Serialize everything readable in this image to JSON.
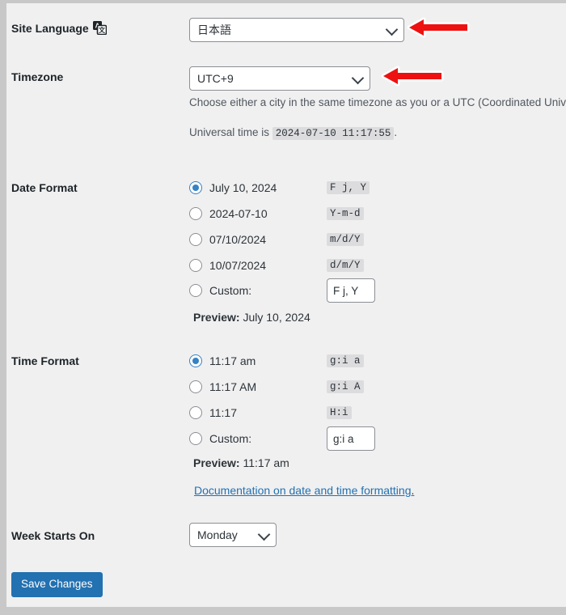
{
  "page": {
    "background": "#c8c8c8",
    "panel_background": "#f0f0f1",
    "accent": "#2271b1",
    "radio_accent": "#3582c4",
    "arrow_color": "#ee1111"
  },
  "site_language": {
    "label": "Site Language",
    "icon": "translation-icon",
    "value": "日本語"
  },
  "timezone": {
    "label": "Timezone",
    "value": "UTC+9",
    "description": "Choose either a city in the same timezone as you or a UTC (Coordinated Universal Time) time offset.",
    "universal_time_prefix": "Universal time is",
    "universal_time_value": "2024-07-10 11:17:55",
    "universal_time_suffix": "."
  },
  "date_format": {
    "label": "Date Format",
    "options": [
      {
        "display": "July 10, 2024",
        "code": "F j, Y",
        "selected": true
      },
      {
        "display": "2024-07-10",
        "code": "Y-m-d",
        "selected": false
      },
      {
        "display": "07/10/2024",
        "code": "m/d/Y",
        "selected": false
      },
      {
        "display": "10/07/2024",
        "code": "d/m/Y",
        "selected": false
      }
    ],
    "custom_label": "Custom:",
    "custom_selected": false,
    "custom_value": "F j, Y",
    "preview_label": "Preview:",
    "preview_value": "July 10, 2024"
  },
  "time_format": {
    "label": "Time Format",
    "options": [
      {
        "display": "11:17 am",
        "code": "g:i a",
        "selected": true
      },
      {
        "display": "11:17 AM",
        "code": "g:i A",
        "selected": false
      },
      {
        "display": "11:17",
        "code": "H:i",
        "selected": false
      }
    ],
    "custom_label": "Custom:",
    "custom_selected": false,
    "custom_value": "g:i a",
    "preview_label": "Preview:",
    "preview_value": "11:17 am",
    "doc_link": "Documentation on date and time formatting",
    "doc_link_period": "."
  },
  "week_starts_on": {
    "label": "Week Starts On",
    "value": "Monday"
  },
  "actions": {
    "save_label": "Save Changes"
  },
  "annotations": [
    {
      "name": "arrow-site-language",
      "direction": "left"
    },
    {
      "name": "arrow-timezone",
      "direction": "left"
    }
  ]
}
